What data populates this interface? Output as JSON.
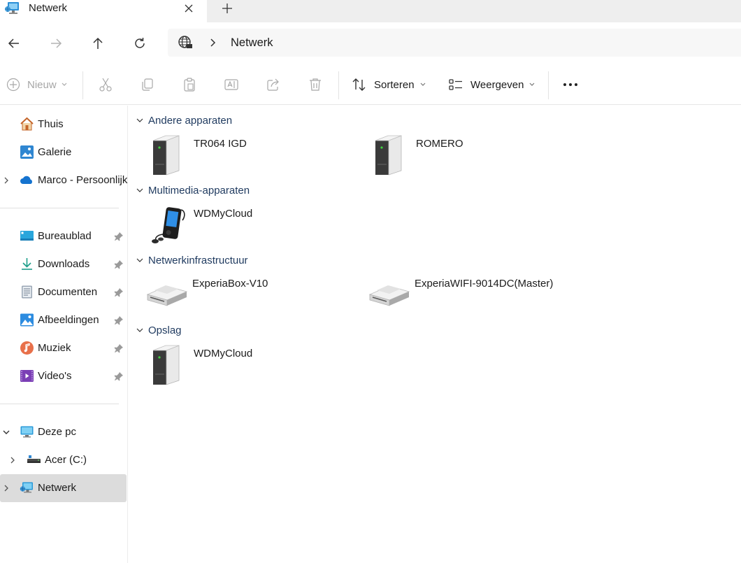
{
  "tab": {
    "title": "Netwerk"
  },
  "address": {
    "crumb": "Netwerk"
  },
  "commands": {
    "new_label": "Nieuw",
    "sort_label": "Sorteren",
    "view_label": "Weergeven",
    "more_label": "..."
  },
  "sidebar": {
    "items": [
      {
        "label": "Thuis"
      },
      {
        "label": "Galerie"
      },
      {
        "label": "Marco - Persoonlijk"
      },
      {
        "label": "Bureaublad"
      },
      {
        "label": "Downloads"
      },
      {
        "label": "Documenten"
      },
      {
        "label": "Afbeeldingen"
      },
      {
        "label": "Muziek"
      },
      {
        "label": "Video's"
      },
      {
        "label": "Deze pc"
      },
      {
        "label": "Acer (C:)"
      },
      {
        "label": "Netwerk"
      }
    ]
  },
  "groups": [
    {
      "title": "Andere apparaten",
      "items": [
        {
          "label": "TR064 IGD",
          "icon": "server-icon"
        },
        {
          "label": "ROMERO",
          "icon": "server-icon"
        }
      ]
    },
    {
      "title": "Multimedia-apparaten",
      "items": [
        {
          "label": "WDMyCloud",
          "icon": "media-player-icon"
        }
      ]
    },
    {
      "title": "Netwerkinfrastructuur",
      "items": [
        {
          "label": "ExperiaBox-V10",
          "icon": "router-icon"
        },
        {
          "label": "ExperiaWIFI-9014DC(Master)",
          "icon": "router-icon"
        }
      ]
    },
    {
      "title": "Opslag",
      "items": [
        {
          "label": "WDMyCloud",
          "icon": "server-icon"
        }
      ]
    }
  ],
  "colors": {
    "accent": "#0a64c8",
    "selected": "#dcdcdc",
    "group_header": "#1f3a5f"
  }
}
